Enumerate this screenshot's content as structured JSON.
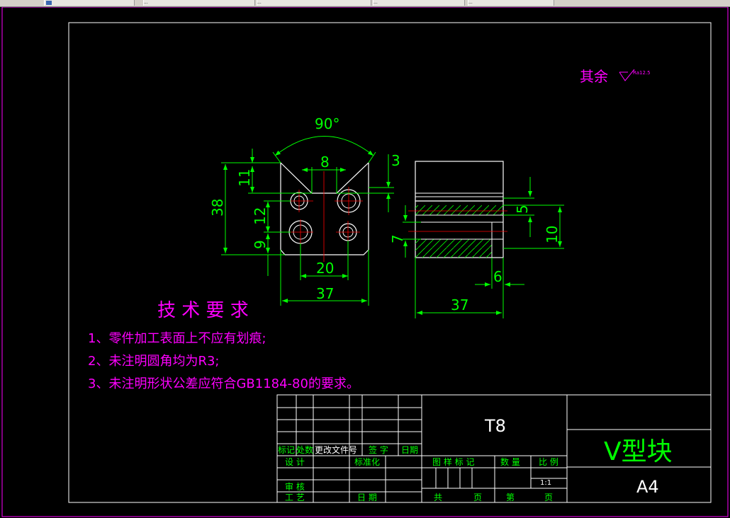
{
  "tabs": [
    {
      "label": ""
    },
    {
      "label": "..."
    },
    {
      "label": "..."
    },
    {
      "label": "..."
    },
    {
      "label": "..."
    }
  ],
  "note": {
    "label": "其余",
    "roughness": "Ra12.5"
  },
  "dims_left": {
    "angle": "90°",
    "d8": "8",
    "d3": "3",
    "d11": "11",
    "d38": "38",
    "d12": "12",
    "d9": "9",
    "d20": "20",
    "d37": "37"
  },
  "dims_right": {
    "d5": "5",
    "d7": "7",
    "d10": "10",
    "d6": "6",
    "d37": "37"
  },
  "tech": {
    "title": "技 术 要 求",
    "items": [
      "1、零件加工表面上不应有划痕;",
      "2、未注明圆角均为R3;",
      "3、未注明形状公差应符合GB1184-80的要求。"
    ]
  },
  "titleblock": {
    "material": "T8",
    "part_name": "V型块",
    "paper_size": "A4",
    "scale": "1:1",
    "labels": {
      "mark": "标记",
      "count": "处数",
      "doc": "更改文件号",
      "sign": "签 字",
      "date": "日期",
      "design": "设 计",
      "standard": "标准化",
      "check": "审 核",
      "process": "工 艺",
      "date2": "日 期",
      "pattern": "图 样 标 记",
      "weight": "数 量",
      "ratio": "比 例",
      "total": "共",
      "page1": "页",
      "nth": "第",
      "page2": "页"
    }
  },
  "colors": {
    "frame": "#ff00ff",
    "geometry": "#ffffff",
    "dimension": "#00ff00",
    "center": "#ff0000",
    "hatch": "#00ff00"
  }
}
